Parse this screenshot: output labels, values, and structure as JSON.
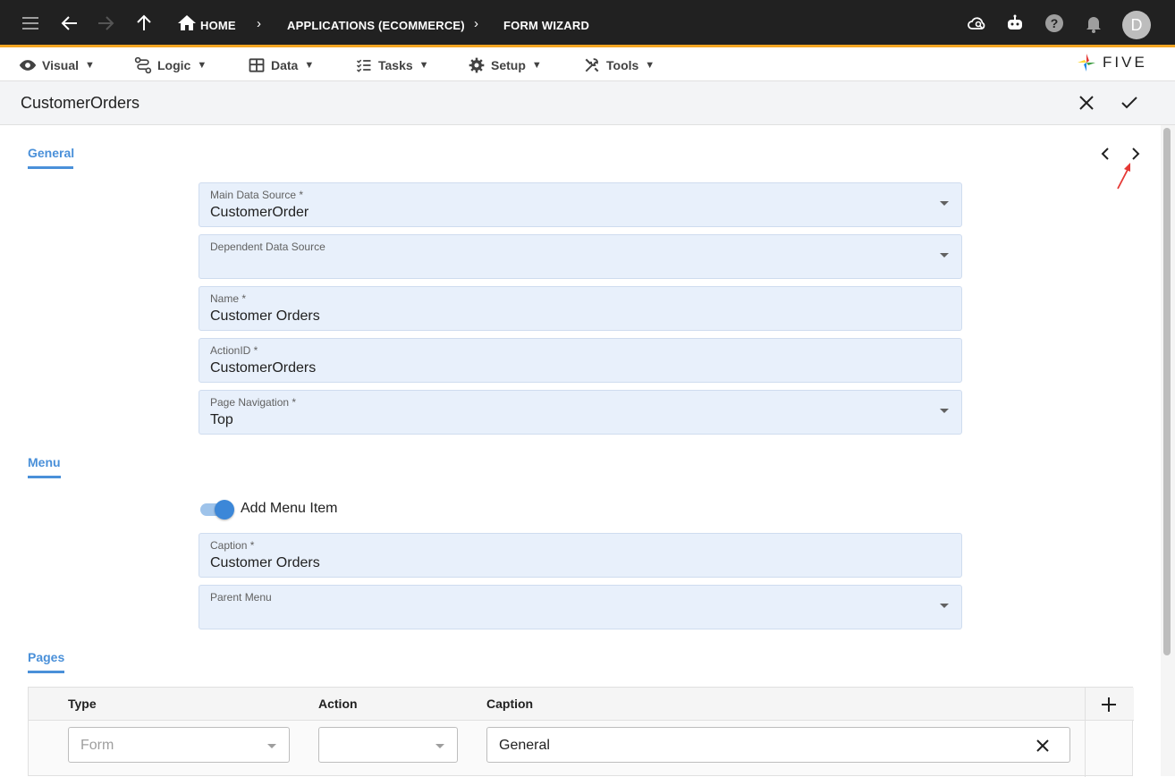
{
  "topbar": {
    "breadcrumbs": [
      "HOME",
      "APPLICATIONS (ECOMMERCE)",
      "FORM WIZARD"
    ],
    "avatar_letter": "D",
    "accent_color": "#f5a623"
  },
  "menubar": {
    "items": [
      {
        "label": "Visual",
        "icon": "eye-icon"
      },
      {
        "label": "Logic",
        "icon": "logic-icon"
      },
      {
        "label": "Data",
        "icon": "table-icon"
      },
      {
        "label": "Tasks",
        "icon": "tasks-icon"
      },
      {
        "label": "Setup",
        "icon": "gear-icon"
      },
      {
        "label": "Tools",
        "icon": "tools-icon"
      }
    ],
    "logo_text": "FIVE"
  },
  "form": {
    "title": "CustomerOrders"
  },
  "sections": {
    "general": "General",
    "menu": "Menu",
    "pages": "Pages"
  },
  "fields": {
    "main_data_source": {
      "label": "Main Data Source *",
      "value": "CustomerOrder"
    },
    "dependent_data_source": {
      "label": "Dependent Data Source",
      "value": ""
    },
    "name": {
      "label": "Name *",
      "value": "Customer Orders"
    },
    "action_id": {
      "label": "ActionID *",
      "value": "CustomerOrders"
    },
    "page_navigation": {
      "label": "Page Navigation *",
      "value": "Top"
    },
    "caption": {
      "label": "Caption *",
      "value": "Customer Orders"
    },
    "parent_menu": {
      "label": "Parent Menu",
      "value": ""
    }
  },
  "toggle": {
    "label": "Add Menu Item",
    "checked": true
  },
  "pages_grid": {
    "columns": [
      "Type",
      "Action",
      "Caption"
    ],
    "rows": [
      {
        "type": "Form",
        "action": "",
        "caption": "General"
      }
    ]
  }
}
